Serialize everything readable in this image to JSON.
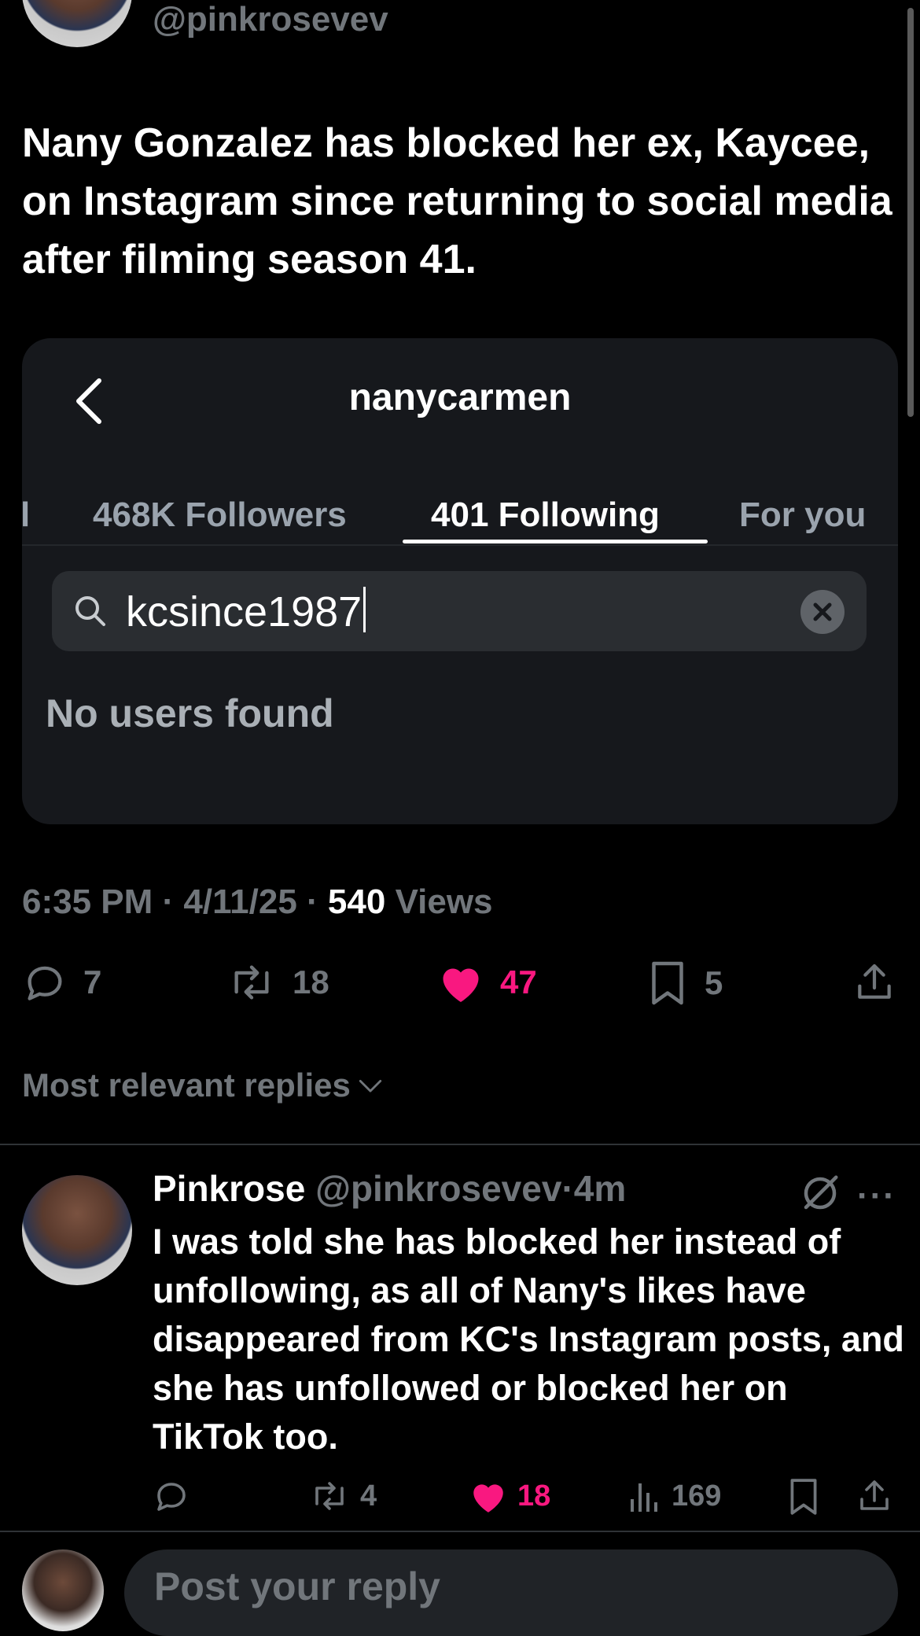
{
  "post": {
    "handle": "@pinkrosevev",
    "text": "Nany Gonzalez has blocked her ex, Kaycee, on Instagram since returning to social media after filming season 41."
  },
  "embedded_screenshot": {
    "title": "nanycarmen",
    "tabs": [
      {
        "label": "l"
      },
      {
        "label": "468K Followers"
      },
      {
        "label": "401 Following",
        "active": true
      },
      {
        "label": "For you"
      }
    ],
    "search_value": "kcsince1987",
    "empty_state": "No users found"
  },
  "meta": {
    "time": "6:35 PM",
    "date": "4/11/25",
    "views_count": "540",
    "views_label": "Views",
    "separator": "·"
  },
  "actions": {
    "replies": "7",
    "reposts": "18",
    "likes": "47",
    "bookmarks": "5"
  },
  "replies_sort": "Most relevant replies",
  "reply": {
    "name": "Pinkrose",
    "handle": "@pinkrosevev",
    "separator": "·",
    "time": "4m",
    "more": "···",
    "text": "I was told she has blocked her instead of unfollowing, as all of Nany's likes have disappeared from KC's Instagram posts, and she has unfollowed or blocked her on TikTok too.",
    "reposts": "4",
    "likes": "18",
    "views": "169"
  },
  "compose": {
    "placeholder": "Post your reply"
  },
  "colors": {
    "background": "#000000",
    "like": "#f91880",
    "muted": "#71767b",
    "card": "#16181c"
  }
}
